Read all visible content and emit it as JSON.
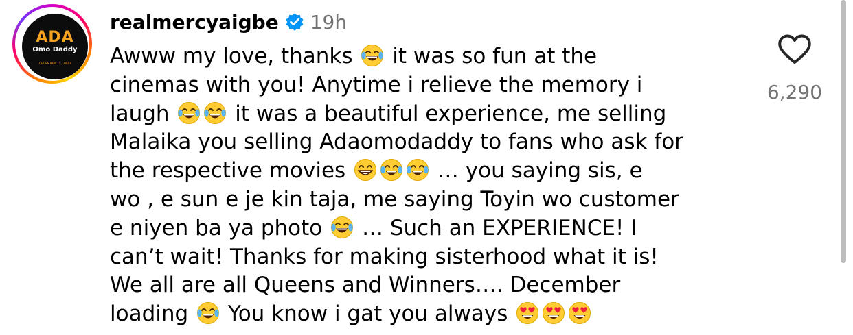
{
  "comment": {
    "avatar": {
      "logo_title": "ADA",
      "logo_subtitle": "Omo Daddy",
      "logo_date": "DECEMBER 15, 2023"
    },
    "username": "realmercyaigbe",
    "verified_icon": "verified-badge-icon",
    "timestamp": "19h",
    "text_lines": [
      [
        "Awww my love, thanks ",
        "laugh",
        " it was so fun at the"
      ],
      [
        "cinemas with you! Anytime i relieve the memory i"
      ],
      [
        "laugh ",
        "laugh",
        "laugh",
        " it was a beautiful experience, me selling"
      ],
      [
        "Malaika you selling Adaomodaddy to fans who ask for"
      ],
      [
        "the respective movies ",
        "grin",
        "laugh",
        "laugh",
        " … you saying sis, e"
      ],
      [
        "wo , e sun e je kin taja, me saying Toyin wo customer"
      ],
      [
        "e niyen ba ya photo ",
        "laugh",
        " … Such an EXPERIENCE! I"
      ],
      [
        "can’t wait! Thanks for making sisterhood what it is!"
      ],
      [
        "We all are all Queens and Winners…. December"
      ],
      [
        "loading ",
        "laugh",
        "  You know i gat you always ",
        "hearteyes",
        "hearteyes",
        "hearteyes"
      ]
    ],
    "emoji_names": {
      "laugh": "face-with-tears-of-joy-emoji",
      "grin": "beaming-face-emoji",
      "hearteyes": "heart-eyes-emoji"
    },
    "like_icon": "heart-outline-icon",
    "like_count": "6,290"
  },
  "colors": {
    "text": "#000000",
    "muted": "#737373",
    "verified": "#0095f6",
    "logo_gold": "#f4a21b",
    "emoji_yellow": "#ffcc33"
  }
}
